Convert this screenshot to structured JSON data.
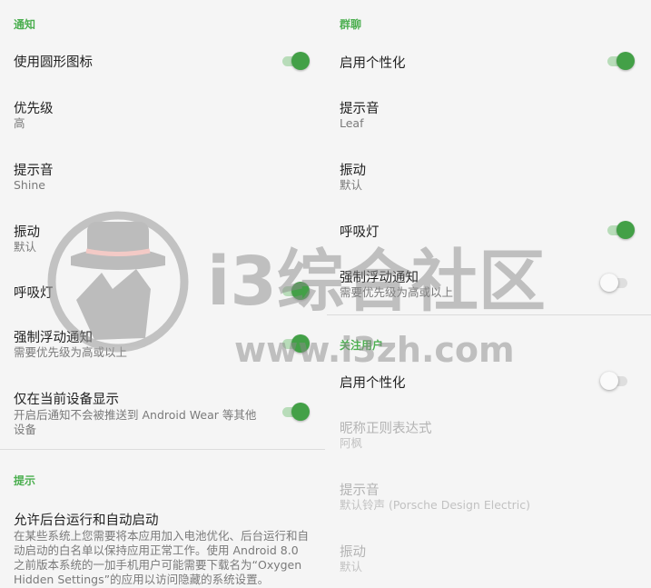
{
  "left": {
    "notification": {
      "header": "通知",
      "round_icon": {
        "title": "使用圆形图标",
        "on": true
      },
      "priority": {
        "title": "优先级",
        "summary": "高"
      },
      "sound": {
        "title": "提示音",
        "summary": "Shine"
      },
      "vibrate": {
        "title": "振动",
        "summary": "默认"
      },
      "breathing_light": {
        "title": "呼吸灯",
        "on": true
      },
      "heads_up": {
        "title": "强制浮动通知",
        "summary": "需要优先级为高或以上",
        "on": true
      },
      "local_only": {
        "title": "仅在当前设备显示",
        "summary": "开启后通知不会被推送到 Android Wear 等其他设备",
        "on": true
      }
    },
    "tips": {
      "header": "提示",
      "background": {
        "title": "允许后台运行和自动启动",
        "summary": "在某些系统上您需要将本应用加入电池优化、后台运行和自动启动的白名单以保持应用正常工作。使用 Android 8.0 之前版本系统的一加手机用户可能需要下载名为“Oxygen Hidden Settings”的应用以访问隐藏的系统设置。"
      }
    }
  },
  "right": {
    "group_chat": {
      "header": "群聊",
      "personalize": {
        "title": "启用个性化",
        "on": true
      },
      "sound": {
        "title": "提示音",
        "summary": "Leaf"
      },
      "vibrate": {
        "title": "振动",
        "summary": "默认"
      },
      "breathing_light": {
        "title": "呼吸灯",
        "on": true
      },
      "heads_up": {
        "title": "强制浮动通知",
        "summary": "需要优先级为高或以上",
        "on": false
      }
    },
    "followed_users": {
      "header": "关注用户",
      "personalize": {
        "title": "启用个性化",
        "on": false
      },
      "nickname_regex": {
        "title": "昵称正则表达式",
        "summary": "阿枫"
      },
      "sound": {
        "title": "提示音",
        "summary": "默认铃声 (Porsche Design Electric)"
      },
      "vibrate": {
        "title": "振动",
        "summary": "默认"
      }
    }
  },
  "watermark": {
    "brand": "i3综合社区",
    "url": "www.i3zh.com"
  },
  "colors": {
    "accent": "#4caf50",
    "toggle_on_thumb": "#43a047",
    "toggle_on_track": "#b8dcb9",
    "background": "#f5f5f5"
  }
}
